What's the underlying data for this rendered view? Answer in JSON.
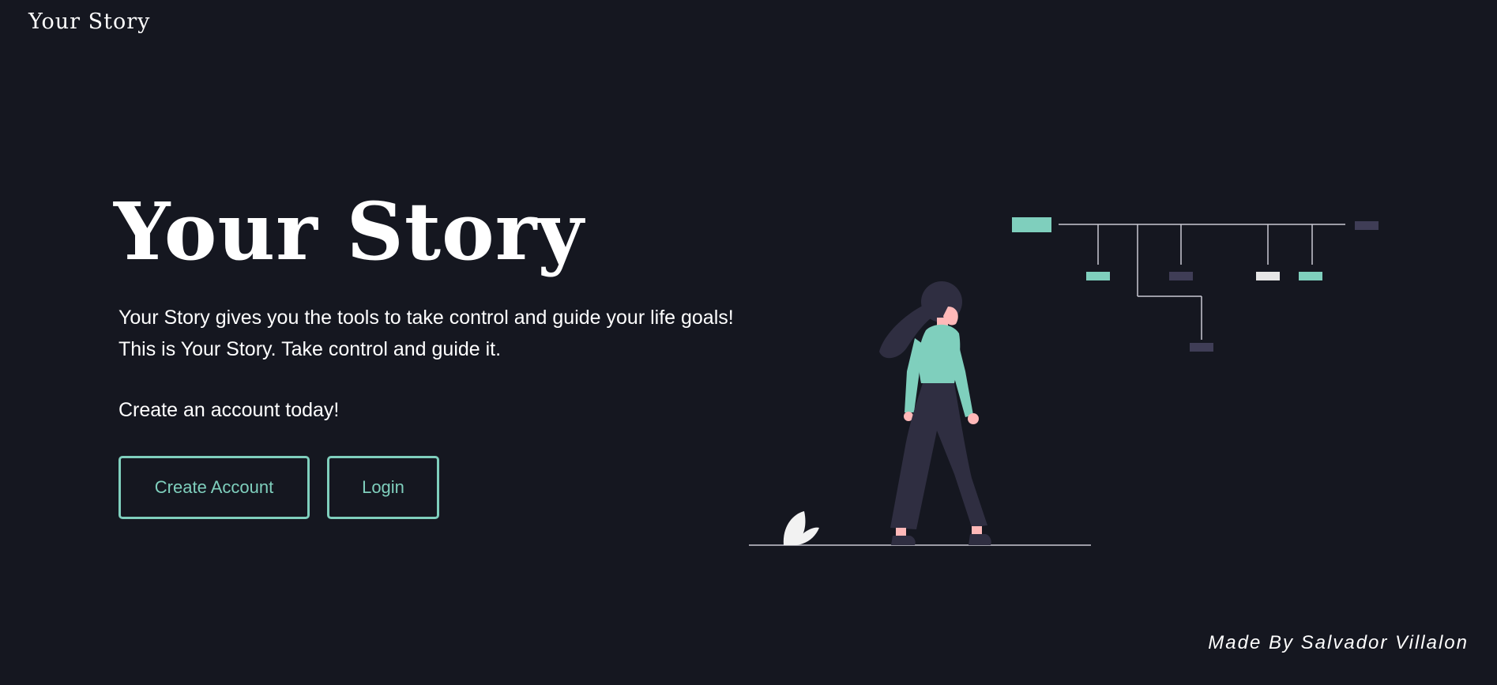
{
  "header": {
    "brand": "Your Story"
  },
  "hero": {
    "title": "Your Story",
    "tagline_line1": "Your Story gives you the tools to take control and guide your life goals!",
    "tagline_line2": "This is Your Story. Take control and guide it.",
    "cta_text": "Create an account today!",
    "create_button_label": "Create Account",
    "login_button_label": "Login"
  },
  "illustration": {
    "name": "woman-walking-timeline-illustration"
  },
  "footer": {
    "credit": "Made By Salvador Villalon"
  },
  "colors": {
    "background": "#151720",
    "accent": "#7fcfbd",
    "text": "#ffffff",
    "figure_dark": "#2f2e41",
    "timeline_block_dark": "#3f3d56",
    "timeline_block_light": "#e6e6e6"
  }
}
